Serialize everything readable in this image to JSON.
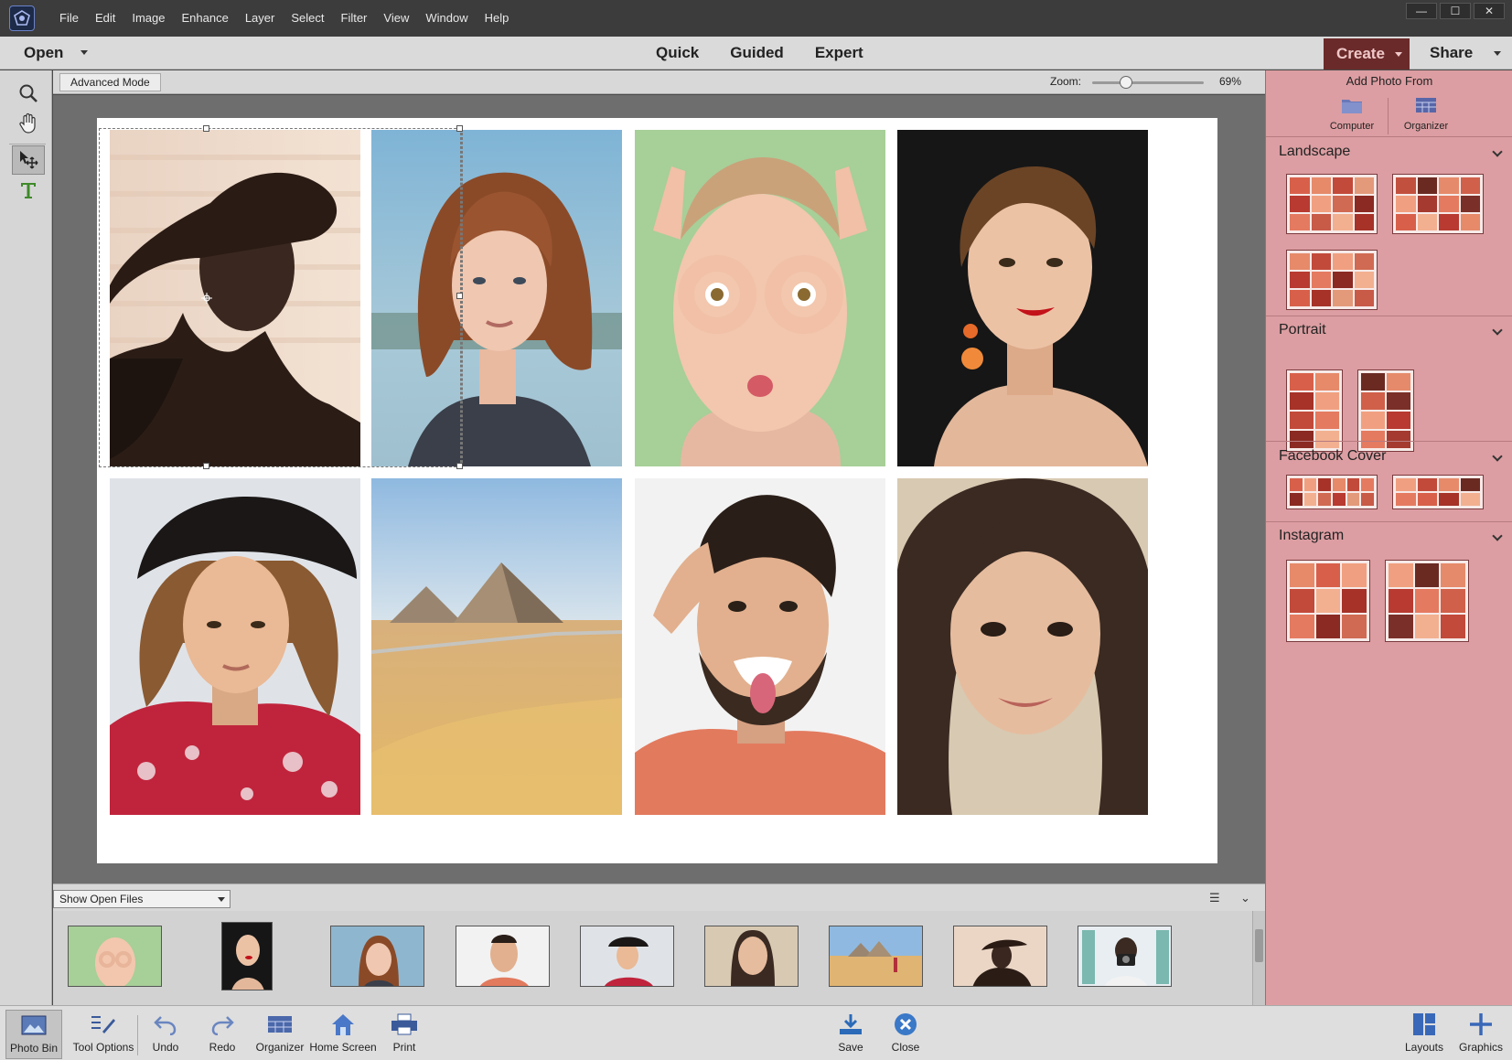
{
  "menubar": {
    "items": [
      "File",
      "Edit",
      "Image",
      "Enhance",
      "Layer",
      "Select",
      "Filter",
      "View",
      "Window",
      "Help"
    ],
    "window_controls": [
      "—",
      "☐",
      "✕"
    ]
  },
  "modebar": {
    "open_label": "Open",
    "tabs": [
      "Quick",
      "Guided",
      "Expert"
    ],
    "create_label": "Create",
    "share_label": "Share"
  },
  "optbar": {
    "advanced_mode_label": "Advanced Mode",
    "zoom_label": "Zoom:",
    "zoom_value": "69%",
    "zoom_level": 0.3
  },
  "right_panel": {
    "add_photo_from": "Add Photo From",
    "computer_label": "Computer",
    "organizer_label": "Organizer",
    "sections": {
      "landscape": "Landscape",
      "portrait": "Portrait",
      "facebook": "Facebook Cover",
      "instagram": "Instagram"
    }
  },
  "photo_bin": {
    "show_files_label": "Show Open Files"
  },
  "taskbar": {
    "photo_bin": "Photo Bin",
    "tool_options": "Tool Options",
    "undo": "Undo",
    "redo": "Redo",
    "organizer": "Organizer",
    "home_screen": "Home Screen",
    "print": "Print",
    "save": "Save",
    "close": "Close",
    "layouts": "Layouts",
    "graphics": "Graphics"
  },
  "colors": {
    "accent": "#6b2a2a",
    "panel": "#dc9ea2"
  },
  "icons": [
    "zoom-icon",
    "hand-icon",
    "move-icon",
    "type-icon",
    "folder-icon",
    "organizer-icon",
    "undo-icon",
    "redo-icon",
    "home-icon",
    "print-icon",
    "save-icon",
    "close-icon",
    "layouts-icon",
    "graphics-icon"
  ]
}
